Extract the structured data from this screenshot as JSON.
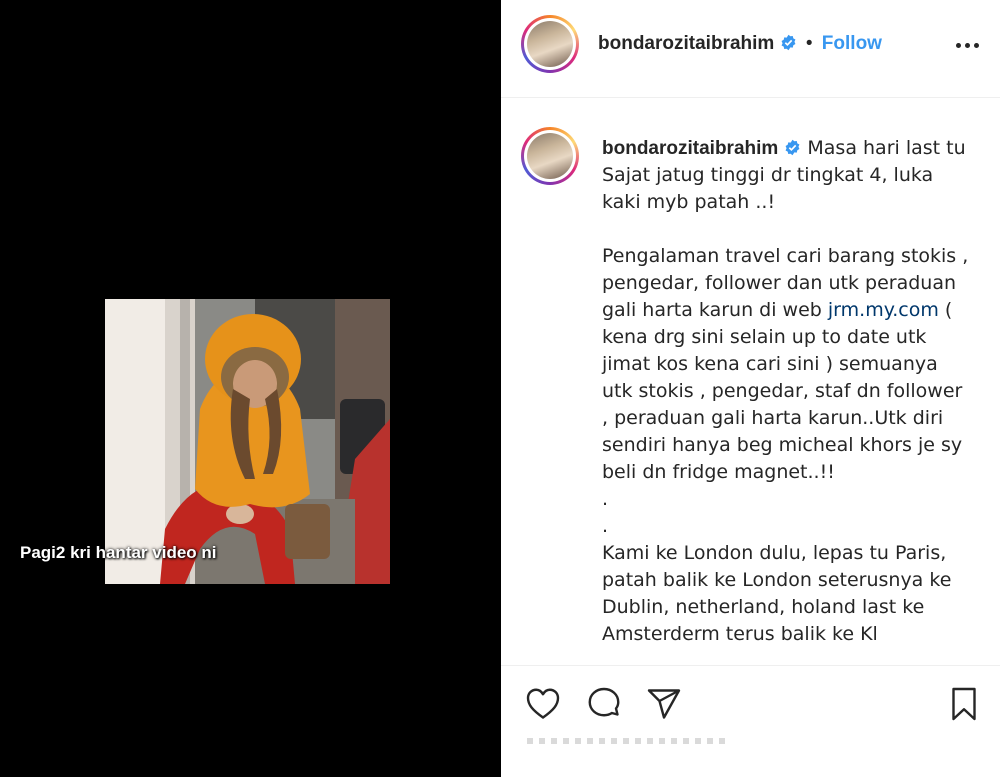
{
  "media": {
    "caption": "Pagi2 kri hantar video ni"
  },
  "header": {
    "username": "bondarozitaibrahim",
    "separator": "•",
    "follow_label": "Follow",
    "more_icon": "more-horizontal-icon"
  },
  "post": {
    "username": "bondarozitaibrahim",
    "text_before_link": "Masa hari last tu Sajat jatug tinggi dr tingkat 4, luka kaki myb patah ..!\n\nPengalaman travel cari barang stokis , pengedar, follower dan utk peraduan gali harta karun di web ",
    "link": "jrm.my.com",
    "text_after_link": " ( kena drg sini selain up to date utk jimat kos kena cari sini ) semuanya utk stokis , pengedar, staf dn follower , peraduan gali harta karun..Utk diri sendiri hanya beg micheal khors je sy beli dn fridge magnet..!!\n.\n.\nKami ke London dulu, lepas tu Paris, patah balik ke London seterusnya ke Dublin, netherland, holand last ke Amsterderm terus balik ke Kl"
  },
  "actions": {
    "like_icon": "heart-icon",
    "comment_icon": "comment-bubble-icon",
    "share_icon": "paper-plane-icon",
    "save_icon": "bookmark-icon"
  },
  "colors": {
    "accent": "#3897f0",
    "verified": "#3897f0",
    "text": "#262626",
    "link": "#00376b"
  }
}
